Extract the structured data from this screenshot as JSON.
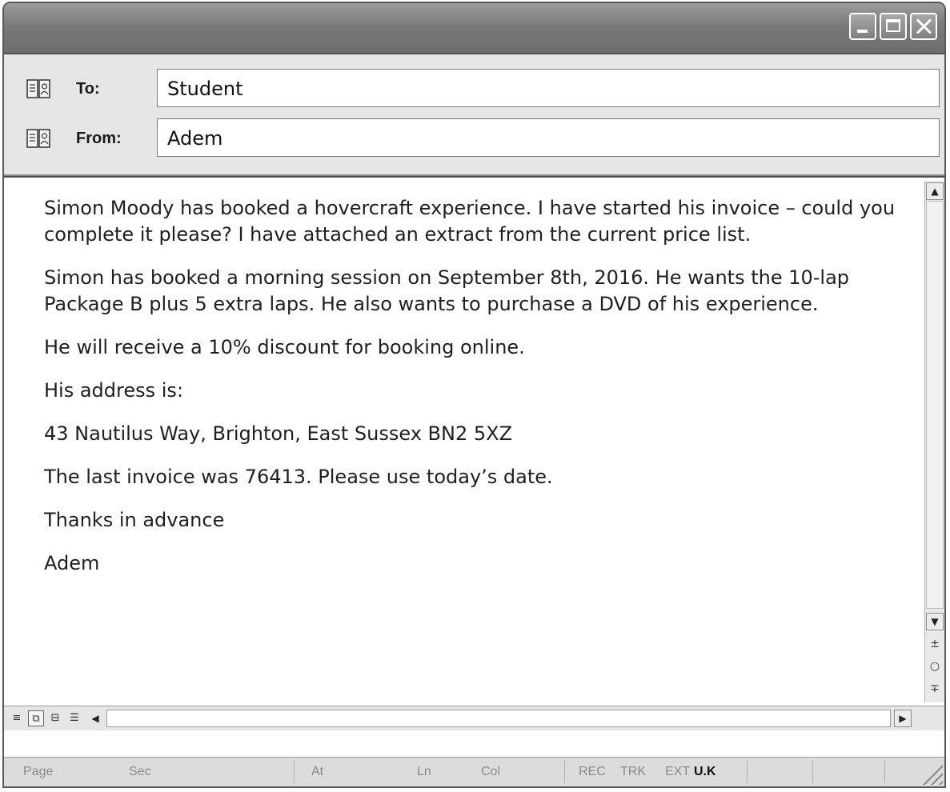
{
  "window": {
    "controls": {
      "minimize_icon": "minimize-icon",
      "maximize_icon": "maximize-icon",
      "close_icon": "close-icon"
    }
  },
  "header": {
    "to_label": "To:",
    "to_value": "Student",
    "from_label": "From:",
    "from_value": "Adem",
    "address_book_icon": "address-book-icon"
  },
  "message": {
    "paragraphs": [
      "Simon Moody has booked a hovercraft experience. I have started his invoice – could you complete it please? I have attached an extract from the current price list.",
      "Simon has booked a morning session on September 8th, 2016. He wants the 10-lap Package B plus 5 extra laps. He also wants to purchase a DVD of his experience.",
      "He will receive a 10% discount for booking online.",
      "His address is:",
      "43 Nautilus Way, Brighton, East Sussex BN2 5XZ",
      "The last invoice was 76413. Please use today’s date.",
      "Thanks in advance",
      "Adem"
    ]
  },
  "statusbar": {
    "page": "Page",
    "sec": "Sec",
    "at": "At",
    "ln": "Ln",
    "col": "Col",
    "rec": "REC",
    "trk": "TRK",
    "ext": "EXT",
    "lang": "U.K"
  },
  "colors": {
    "titlebar": "#7a7a7a",
    "header_bg": "#e6e6e6",
    "body_bg": "#ffffff",
    "text": "#1f1f1f"
  }
}
